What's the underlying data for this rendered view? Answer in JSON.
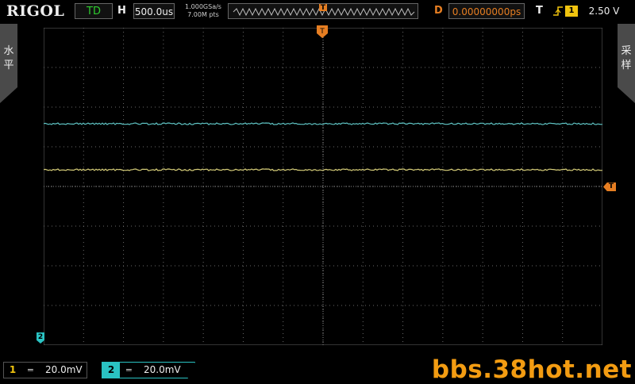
{
  "header": {
    "brand": "RIGOL",
    "mode": "TD",
    "h_label": "H",
    "timebase": "500.0us",
    "sample_rate": "1.000GSa/s",
    "memory_depth": "7.00M pts",
    "trigger_pos_marker": "T",
    "d_label": "D",
    "delay": "0.00000000ps",
    "t_label": "T",
    "trigger_source": "1",
    "trigger_level": "2.50 V"
  },
  "sidebar": {
    "left_label": "水平",
    "right_label": "采样"
  },
  "markers": {
    "trigger_level_marker": "T",
    "ch2_ground_marker": "2"
  },
  "channels": [
    {
      "number": "1",
      "coupling": "═",
      "scale": "20.0mV",
      "color": "#f1c40f"
    },
    {
      "number": "2",
      "coupling": "═",
      "scale": "20.0mV",
      "color": "#2ac3c3"
    }
  ],
  "watermark": "bbs.38hot.net",
  "colors": {
    "ch1": "#d8cf7a",
    "ch2": "#5fc4c4",
    "grid": "#555555",
    "accent": "#e67e22"
  }
}
